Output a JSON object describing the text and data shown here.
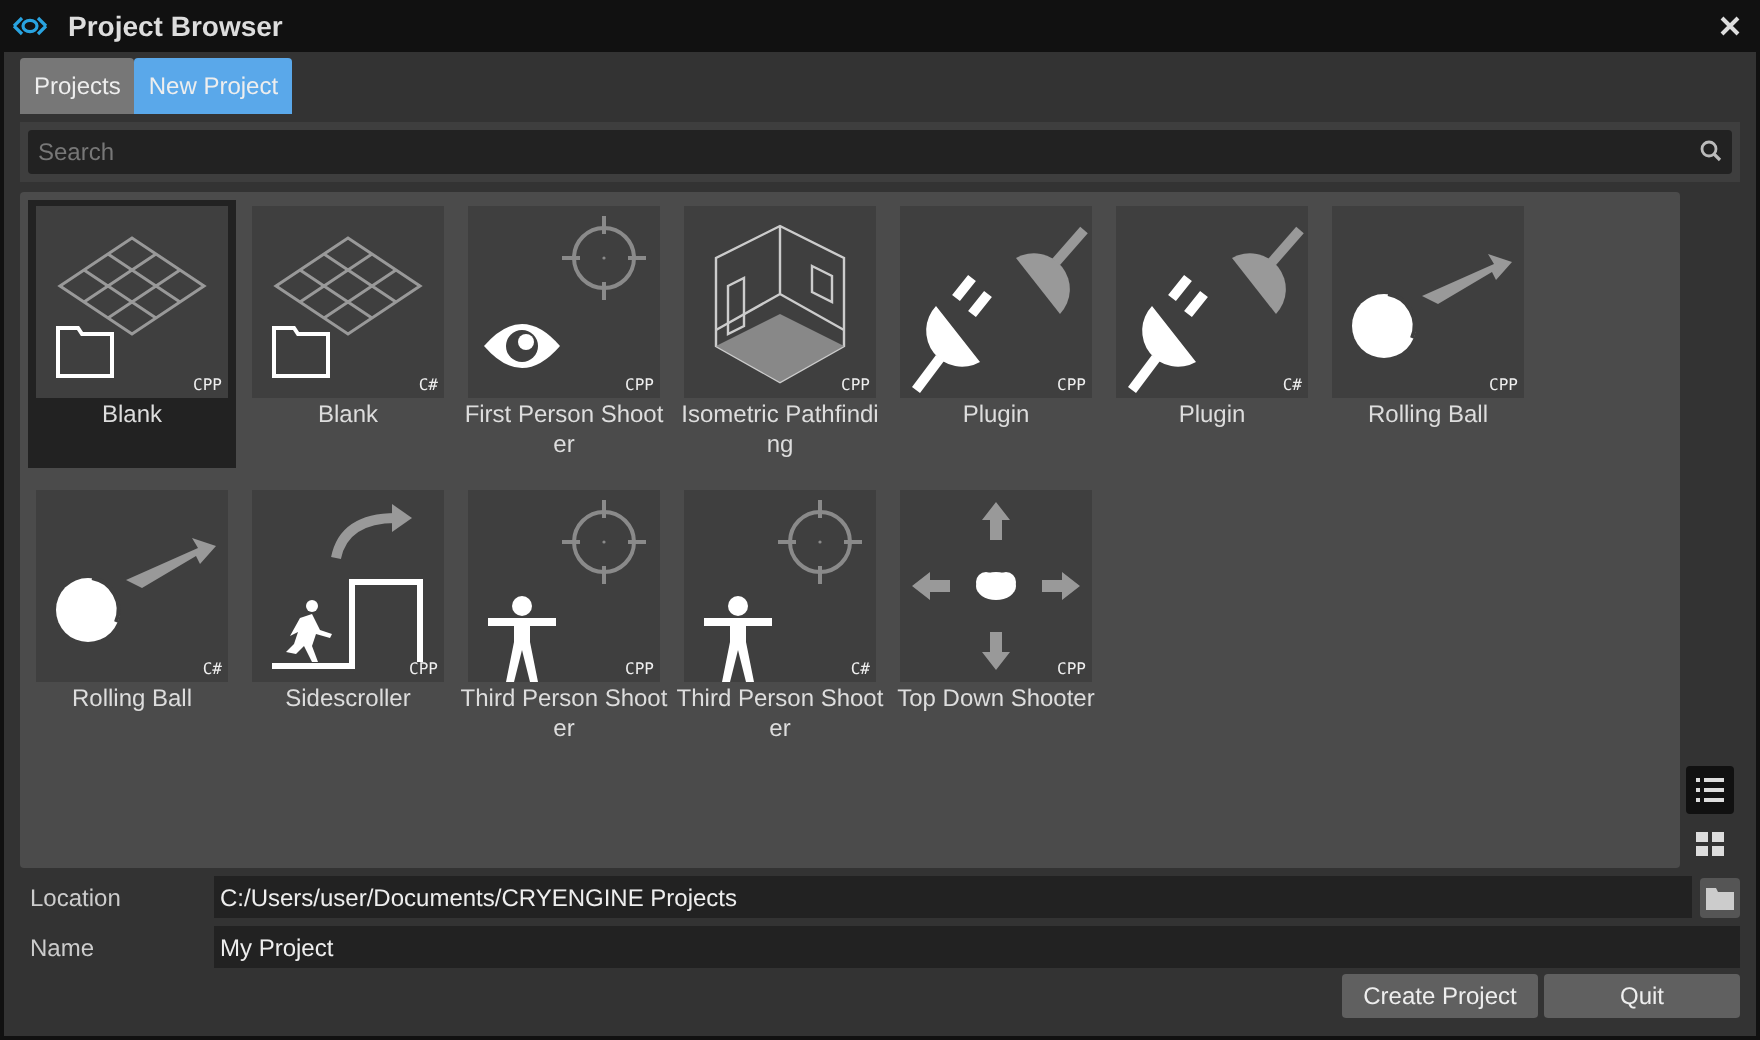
{
  "window": {
    "title": "Project Browser"
  },
  "tabs": [
    {
      "label": "Projects",
      "selected": false
    },
    {
      "label": "New Project",
      "selected": true
    }
  ],
  "search": {
    "placeholder": "Search"
  },
  "templates": [
    {
      "name": "Blank",
      "language": "CPP",
      "kind": "blank",
      "selected": true
    },
    {
      "name": "Blank",
      "language": "C#",
      "kind": "blank",
      "selected": false
    },
    {
      "name": "First Person Shooter",
      "language": "CPP",
      "kind": "first-person",
      "selected": false
    },
    {
      "name": "Isometric Pathfinding",
      "language": "CPP",
      "kind": "isometric",
      "selected": false
    },
    {
      "name": "Plugin",
      "language": "CPP",
      "kind": "plugin",
      "selected": false
    },
    {
      "name": "Plugin",
      "language": "C#",
      "kind": "plugin",
      "selected": false
    },
    {
      "name": "Rolling Ball",
      "language": "CPP",
      "kind": "ball",
      "selected": false
    },
    {
      "name": "Rolling Ball",
      "language": "C#",
      "kind": "ball",
      "selected": false
    },
    {
      "name": "Sidescroller",
      "language": "CPP",
      "kind": "sidescroller",
      "selected": false
    },
    {
      "name": "Third Person Shooter",
      "language": "CPP",
      "kind": "third-person",
      "selected": false
    },
    {
      "name": "Third Person Shooter",
      "language": "C#",
      "kind": "third-person",
      "selected": false
    },
    {
      "name": "Top Down Shooter",
      "language": "CPP",
      "kind": "top-down",
      "selected": false
    }
  ],
  "view_modes": [
    {
      "kind": "list",
      "selected": true
    },
    {
      "kind": "grid",
      "selected": false
    }
  ],
  "location": {
    "label": "Location",
    "value": "C:/Users/user/Documents/CRYENGINE Projects"
  },
  "name_field": {
    "label": "Name",
    "value": "My Project"
  },
  "buttons": [
    "Create Project",
    "Quit"
  ]
}
